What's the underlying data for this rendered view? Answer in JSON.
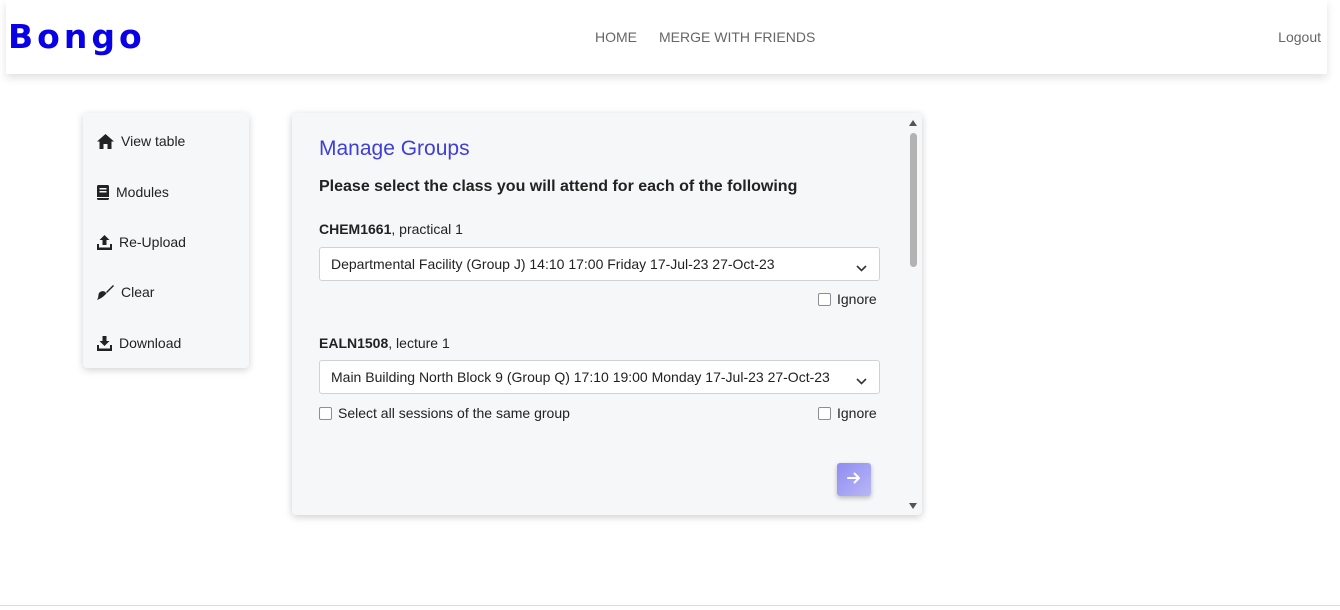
{
  "app": {
    "brand": "Bongo"
  },
  "nav": {
    "home": "HOME",
    "merge": "MERGE WITH FRIENDS",
    "logout": "Logout"
  },
  "sidebar": {
    "items": [
      {
        "label": "View table",
        "icon": "home-icon"
      },
      {
        "label": "Modules",
        "icon": "book-icon"
      },
      {
        "label": "Re-Upload",
        "icon": "upload-icon"
      },
      {
        "label": "Clear",
        "icon": "broom-icon"
      },
      {
        "label": "Download",
        "icon": "download-icon"
      }
    ]
  },
  "main": {
    "title": "Manage Groups",
    "subtitle": "Please select the class you will attend for each of the following",
    "courses": [
      {
        "code": "CHEM1661",
        "type": ", practical 1",
        "selected": "Departmental Facility (Group J) 14:10 17:00 Friday 17-Jul-23 27-Oct-23",
        "ignore_label": "Ignore"
      },
      {
        "code": "EALN1508",
        "type": ", lecture 1",
        "selected": "Main Building North Block 9 (Group Q) 17:10 19:00 Monday 17-Jul-23 27-Oct-23",
        "select_all_label": "Select all sessions of the same group",
        "ignore_label": "Ignore"
      }
    ]
  },
  "colors": {
    "brand": "#0a00e6",
    "title": "#3f3ed6",
    "next_button": "#8f8cf2"
  }
}
